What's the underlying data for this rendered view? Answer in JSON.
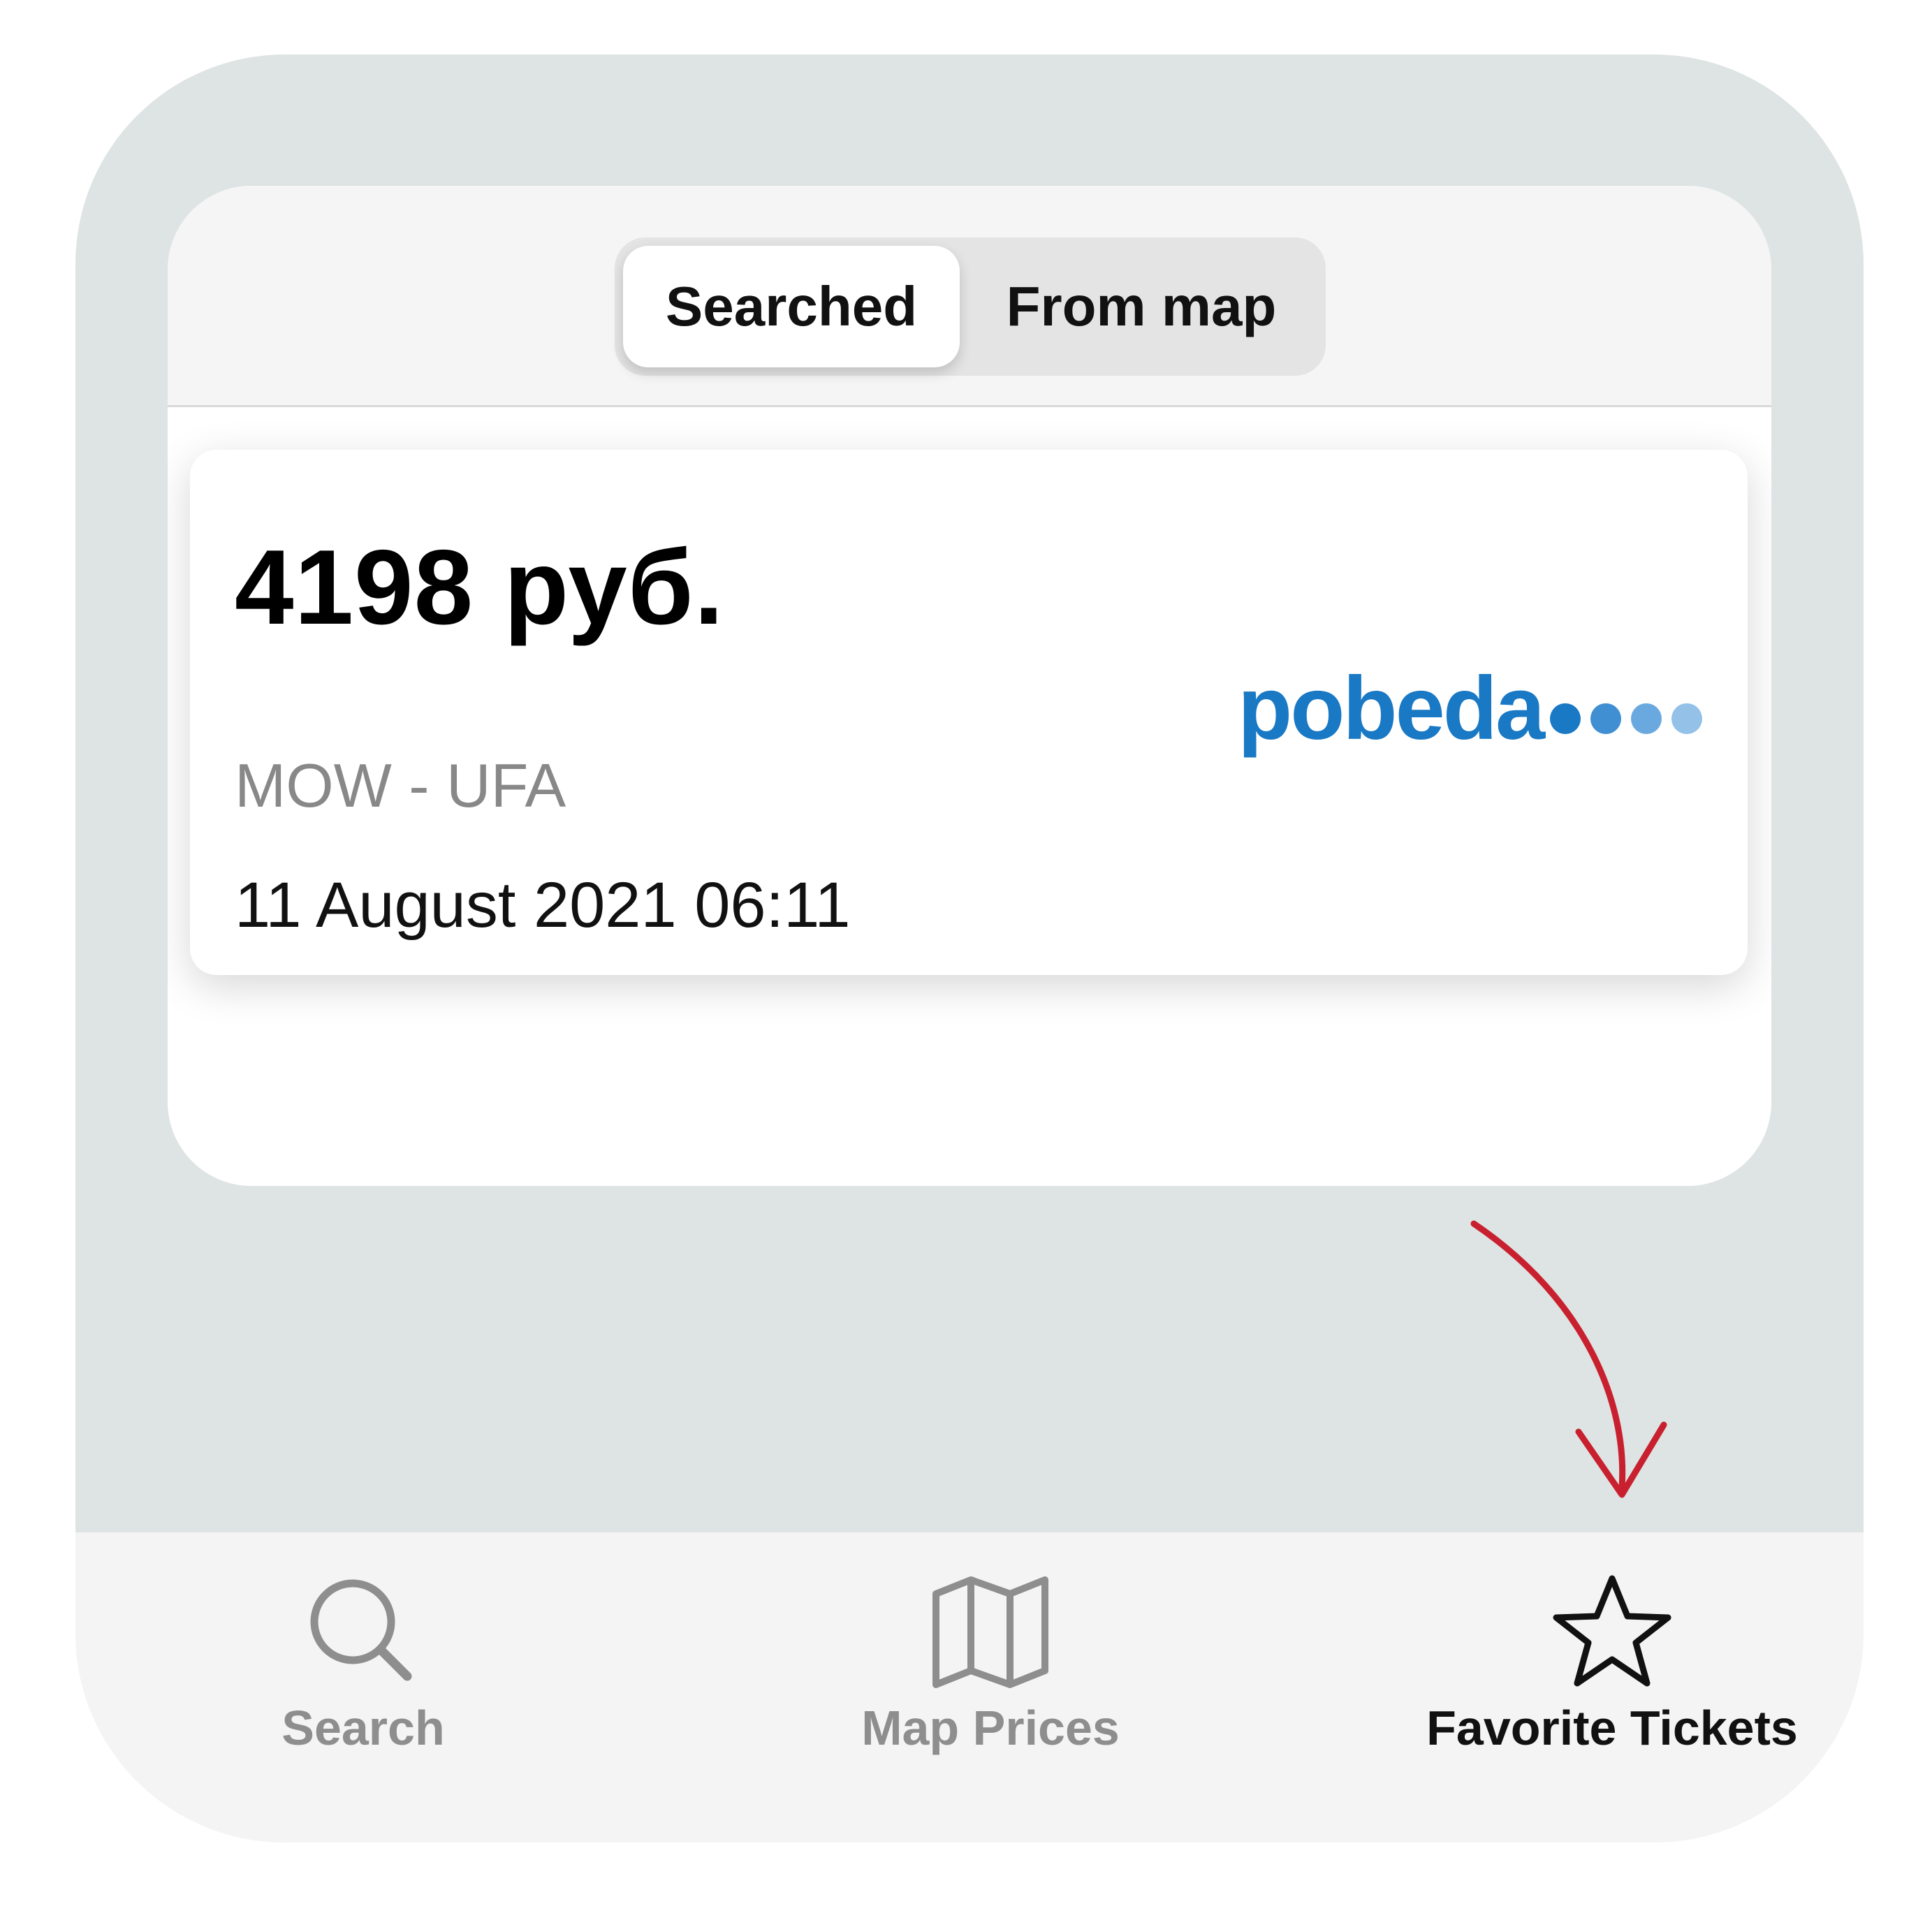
{
  "segmented_control": {
    "options": [
      {
        "label": "Searched",
        "selected": true
      },
      {
        "label": "From map",
        "selected": false
      }
    ]
  },
  "ticket": {
    "price": "4198 руб.",
    "route": "MOW - UFA",
    "datetime": "11 August 2021 06:11",
    "airline_logo_text": "pobeda"
  },
  "tabbar": {
    "tabs": [
      {
        "label": "Search",
        "icon": "search-icon",
        "selected": false
      },
      {
        "label": "Map Prices",
        "icon": "map-icon",
        "selected": false
      },
      {
        "label": "Favorite Tickets",
        "icon": "star-icon",
        "selected": true
      }
    ]
  },
  "colors": {
    "background": "#dee4e3",
    "brand_blue": "#1a79c4",
    "arrow_red": "#c8202e",
    "tab_inactive": "#8e8e8e",
    "tab_active": "#111111"
  }
}
